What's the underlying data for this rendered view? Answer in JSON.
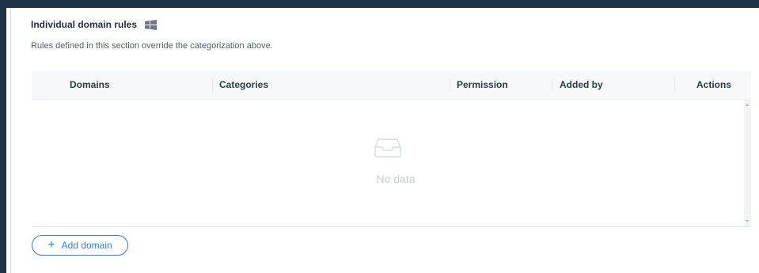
{
  "section": {
    "title": "Individual domain rules",
    "platform_icon": "windows-icon",
    "description": "Rules defined in this section override the categorization above."
  },
  "table": {
    "columns": [
      "Domains",
      "Categories",
      "Permission",
      "Added by",
      "Actions"
    ],
    "rows": [],
    "empty_text": "No data",
    "empty_icon": "empty-inbox-icon"
  },
  "actions": {
    "add_domain_label": "Add domain",
    "add_domain_icon": "plus-icon"
  },
  "colors": {
    "accent": "#2f7fd8",
    "header_bg": "#f7f8f9",
    "page_bg": "#1c3348"
  }
}
